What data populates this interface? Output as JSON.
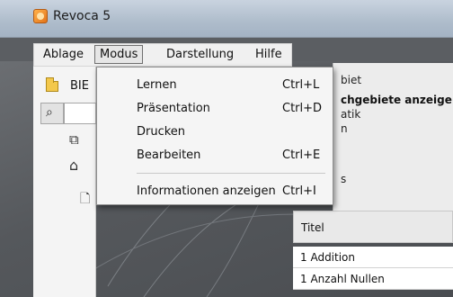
{
  "window": {
    "title": "Revoca 5"
  },
  "menubar": {
    "items": [
      {
        "label": "Ablage"
      },
      {
        "label": "Modus"
      },
      {
        "label": "Darstellung"
      },
      {
        "label": "Hilfe"
      }
    ]
  },
  "dropdown": {
    "items": [
      {
        "label": "Lernen",
        "shortcut": "Ctrl+L"
      },
      {
        "label": "Präsentation",
        "shortcut": "Ctrl+D"
      },
      {
        "label": "Drucken",
        "shortcut": ""
      },
      {
        "label": "Bearbeiten",
        "shortcut": "Ctrl+E"
      },
      {
        "label": "Informationen anzeigen",
        "shortcut": "Ctrl+I"
      }
    ]
  },
  "sidebar": {
    "label": "BIE"
  },
  "right_panel": {
    "title": "biet",
    "bold_line": "chgebiete anzeige",
    "line1": "atik",
    "line2": "n",
    "line3": "s"
  },
  "table": {
    "header": "Titel",
    "rows": [
      "1 Addition",
      "1 Anzahl Nullen"
    ]
  }
}
